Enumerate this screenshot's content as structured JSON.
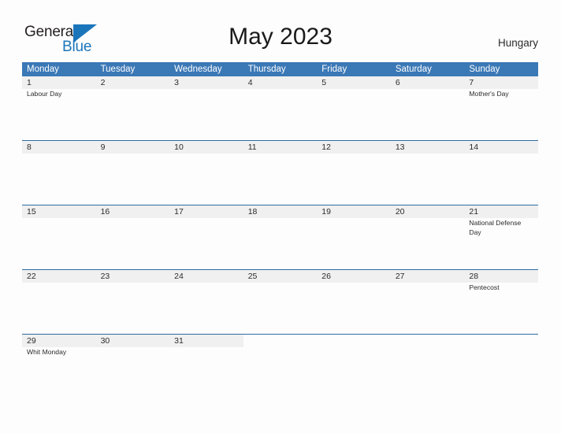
{
  "brand": {
    "name_part1": "General",
    "name_part2": "Blue",
    "logo_icon": "flag-triangle-icon"
  },
  "header": {
    "title": "May 2023",
    "country": "Hungary"
  },
  "colors": {
    "header_blue": "#3b78b6",
    "row_divider_blue": "#2e6da4",
    "daynum_band_gray": "#f0f0f0",
    "brand_blue": "#1b75bb",
    "text_dark": "#2b2b2b"
  },
  "calendar": {
    "weekdays": [
      "Monday",
      "Tuesday",
      "Wednesday",
      "Thursday",
      "Friday",
      "Saturday",
      "Sunday"
    ],
    "weeks": [
      {
        "filled_columns": 7,
        "days": [
          {
            "number": "1",
            "events": [
              "Labour Day"
            ]
          },
          {
            "number": "2",
            "events": []
          },
          {
            "number": "3",
            "events": []
          },
          {
            "number": "4",
            "events": []
          },
          {
            "number": "5",
            "events": []
          },
          {
            "number": "6",
            "events": []
          },
          {
            "number": "7",
            "events": [
              "Mother's Day"
            ]
          }
        ]
      },
      {
        "filled_columns": 7,
        "days": [
          {
            "number": "8",
            "events": []
          },
          {
            "number": "9",
            "events": []
          },
          {
            "number": "10",
            "events": []
          },
          {
            "number": "11",
            "events": []
          },
          {
            "number": "12",
            "events": []
          },
          {
            "number": "13",
            "events": []
          },
          {
            "number": "14",
            "events": []
          }
        ]
      },
      {
        "filled_columns": 7,
        "days": [
          {
            "number": "15",
            "events": []
          },
          {
            "number": "16",
            "events": []
          },
          {
            "number": "17",
            "events": []
          },
          {
            "number": "18",
            "events": []
          },
          {
            "number": "19",
            "events": []
          },
          {
            "number": "20",
            "events": []
          },
          {
            "number": "21",
            "events": [
              "National Defense Day"
            ]
          }
        ]
      },
      {
        "filled_columns": 7,
        "days": [
          {
            "number": "22",
            "events": []
          },
          {
            "number": "23",
            "events": []
          },
          {
            "number": "24",
            "events": []
          },
          {
            "number": "25",
            "events": []
          },
          {
            "number": "26",
            "events": []
          },
          {
            "number": "27",
            "events": []
          },
          {
            "number": "28",
            "events": [
              "Pentecost"
            ]
          }
        ]
      },
      {
        "filled_columns": 3,
        "days": [
          {
            "number": "29",
            "events": [
              "Whit Monday"
            ]
          },
          {
            "number": "30",
            "events": []
          },
          {
            "number": "31",
            "events": []
          }
        ]
      }
    ]
  }
}
